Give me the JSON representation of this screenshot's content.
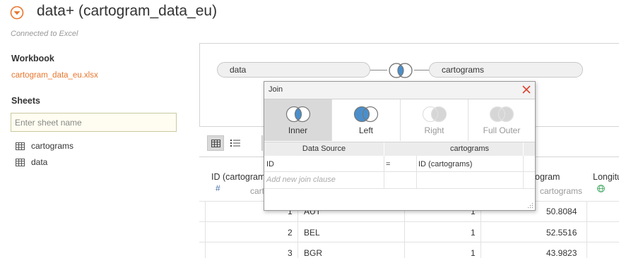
{
  "header": {
    "title": "data+ (cartogram_data_eu)",
    "connection_status": "Connected to Excel",
    "accent_color": "#e8762d"
  },
  "left_panel": {
    "workbook_heading": "Workbook",
    "workbook_file": "cartogram_data_eu.xlsx",
    "sheets_heading": "Sheets",
    "sheet_search_placeholder": "Enter sheet name",
    "sheets": [
      {
        "label": "cartograms",
        "icon": "table-icon"
      },
      {
        "label": "data",
        "icon": "table-icon"
      }
    ]
  },
  "canvas": {
    "left_table": "data",
    "right_table": "cartograms",
    "join_icon": "inner-join-venn-icon"
  },
  "grid_toolbar": {
    "grid_view_icon": "grid-view-icon",
    "list_view_icon": "list-view-icon"
  },
  "grid": {
    "columns": [
      {
        "name": "ID (cartograms)",
        "type_icon": "#",
        "source": "cartograms"
      },
      {
        "name": "",
        "source": ""
      },
      {
        "name": "",
        "source": ""
      },
      {
        "name": "Latitude (cartograms)",
        "source": "cartograms"
      },
      {
        "name": "Longitude (cartograms)",
        "source": "",
        "type_icon": "globe-icon"
      }
    ],
    "visible_header_fragments": {
      "col1_name": "ID (cartogram",
      "col1_source": "carto",
      "col4_name": "ogram",
      "col4_source": "cartograms",
      "col5_name": "Longitu"
    },
    "rows": [
      {
        "id": "1",
        "code": "AUT",
        "num": "1",
        "lat": "50.8084"
      },
      {
        "id": "2",
        "code": "BEL",
        "num": "1",
        "lat": "52.5516"
      },
      {
        "id": "3",
        "code": "BGR",
        "num": "1",
        "lat": "43.9823"
      }
    ]
  },
  "join_dialog": {
    "title": "Join",
    "types": [
      {
        "label": "Inner",
        "selected": true,
        "enabled": true
      },
      {
        "label": "Left",
        "selected": false,
        "enabled": true
      },
      {
        "label": "Right",
        "selected": false,
        "enabled": false
      },
      {
        "label": "Full Outer",
        "selected": false,
        "enabled": false
      }
    ],
    "clause_headers": {
      "left": "Data Source",
      "right": "cartograms"
    },
    "clauses": [
      {
        "left": "ID",
        "op": "=",
        "right": "ID (cartograms)"
      }
    ],
    "add_clause_placeholder": "Add new join clause",
    "venn_blue": "#4a8fcc",
    "venn_gray": "#d6d6d6"
  }
}
